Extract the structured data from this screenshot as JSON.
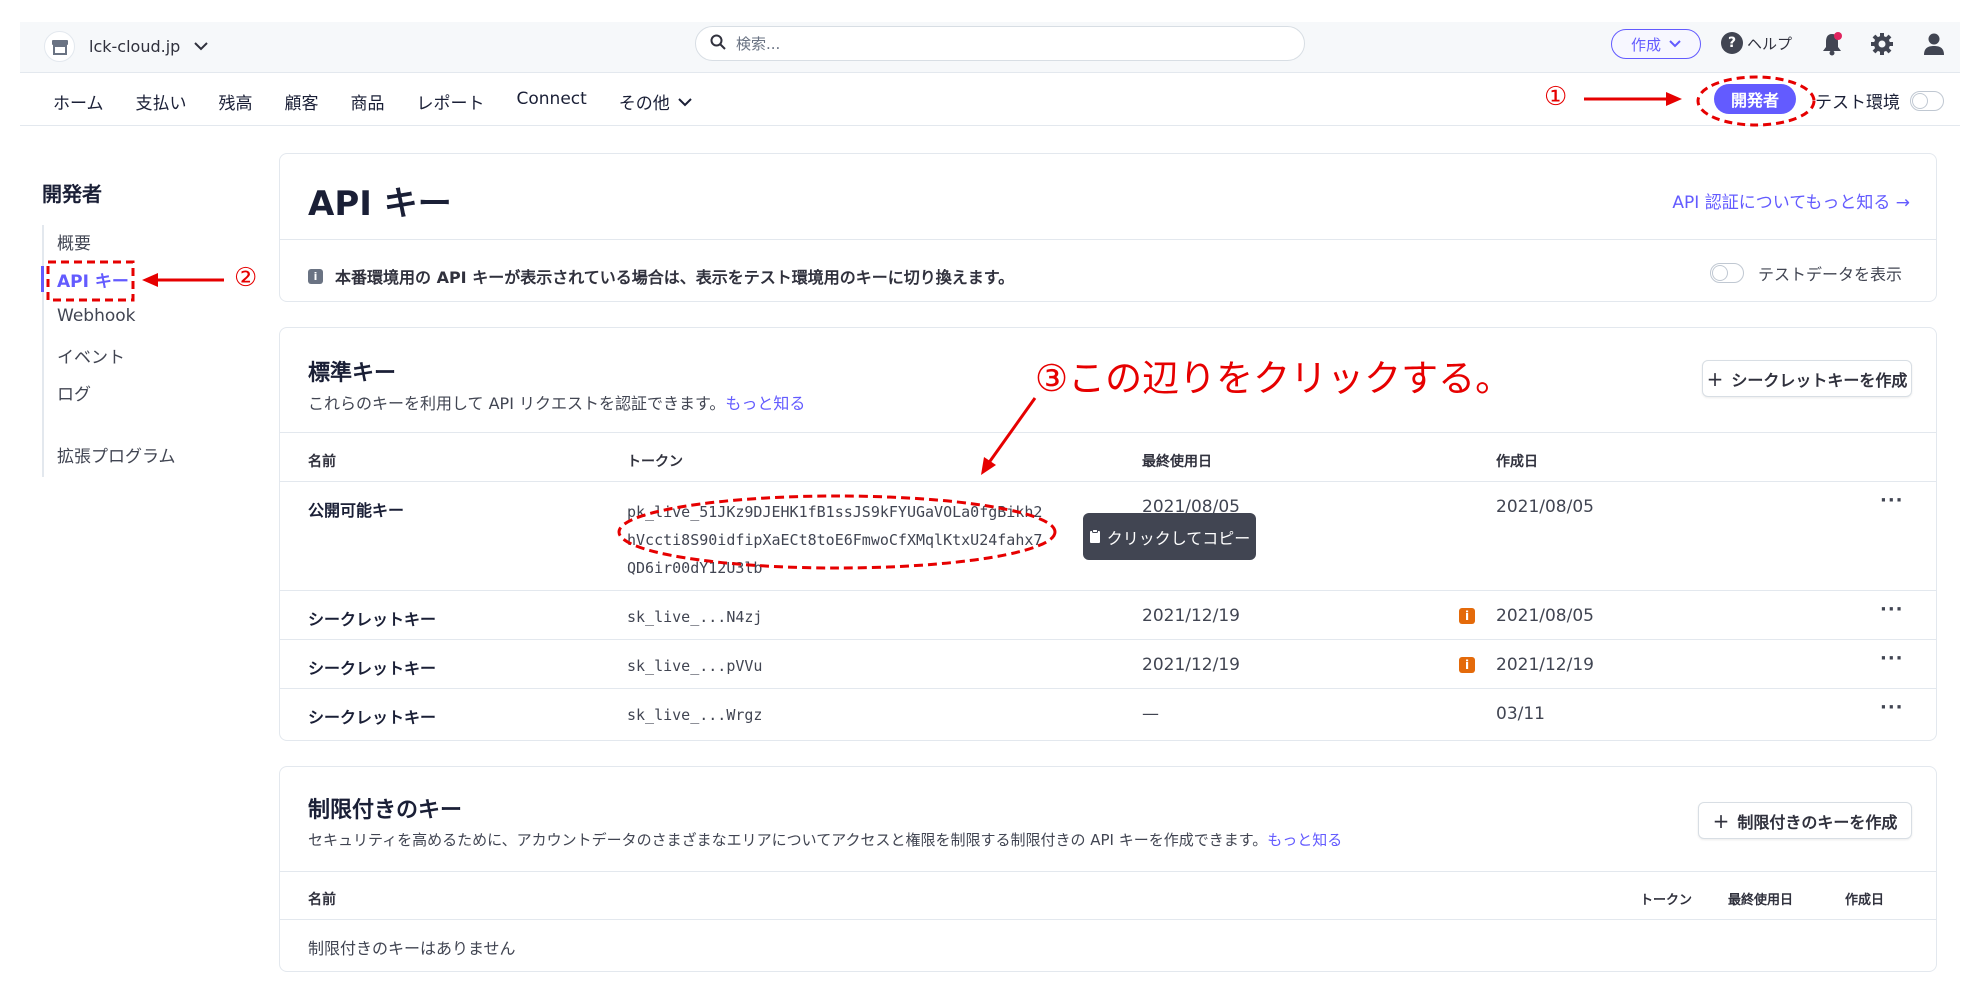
{
  "topbar": {
    "account_name": "lck-cloud.jp",
    "search_placeholder": "検索...",
    "create_label": "作成",
    "help_label": "ヘルプ"
  },
  "nav": {
    "items": [
      "ホーム",
      "支払い",
      "残高",
      "顧客",
      "商品",
      "レポート",
      "Connect",
      "その他"
    ],
    "developer_label": "開発者",
    "test_env_label": "テスト環境"
  },
  "sidebar": {
    "title": "開発者",
    "items": [
      "概要",
      "API キー",
      "Webhook",
      "イベント",
      "ログ",
      "拡張プログラム"
    ]
  },
  "header_card": {
    "title": "API キー",
    "learn_link": "API 認証についてもっと知る →",
    "notice": "本番環境用の API キーが表示されている場合は、表示をテスト環境用のキーに切り換えます。",
    "test_data_label": "テストデータを表示"
  },
  "standard_keys": {
    "title": "標準キー",
    "description": "これらのキーを利用して API リクエストを認証できます。",
    "learn_more": "もっと知る",
    "create_button": "シークレットキーを作成",
    "columns": [
      "名前",
      "トークン",
      "最終使用日",
      "作成日"
    ],
    "rows": [
      {
        "name": "公開可能キー",
        "token_lines": [
          "pk_live_51JKz9DJEHK1fB1ssJS9kFYUGaVOLa0fgBikh2",
          "hVccti8S90idfipXaECt8toE6FmwoCfXMqlKtxU24fahx7",
          "QD6ir00dY12U3lb"
        ],
        "last_used": "2021/08/05",
        "created": "2021/08/05",
        "warn": false
      },
      {
        "name": "シークレットキー",
        "token_lines": [
          "sk_live_...N4zj"
        ],
        "last_used": "2021/12/19",
        "created": "2021/08/05",
        "warn": true
      },
      {
        "name": "シークレットキー",
        "token_lines": [
          "sk_live_...pVVu"
        ],
        "last_used": "2021/12/19",
        "created": "2021/12/19",
        "warn": true
      },
      {
        "name": "シークレットキー",
        "token_lines": [
          "sk_live_...Wrgz"
        ],
        "last_used": "—",
        "created": "03/11",
        "warn": false
      }
    ],
    "tooltip": "クリックしてコピー"
  },
  "restricted_keys": {
    "title": "制限付きのキー",
    "description": "セキュリティを高めるために、アカウントデータのさまざまなエリアについてアクセスと権限を制限する制限付きの API キーを作成できます。",
    "learn_more": "もっと知る",
    "create_button": "制限付きのキーを作成",
    "columns": [
      "名前",
      "トークン",
      "最終使用日",
      "作成日"
    ],
    "empty": "制限付きのキーはありません"
  },
  "annotations": {
    "step1": "①",
    "step2": "②",
    "step3": "③この辺りをクリックする。"
  },
  "colors": {
    "accent": "#635bff",
    "annotation": "#e60000",
    "warning": "#e46a0a"
  }
}
